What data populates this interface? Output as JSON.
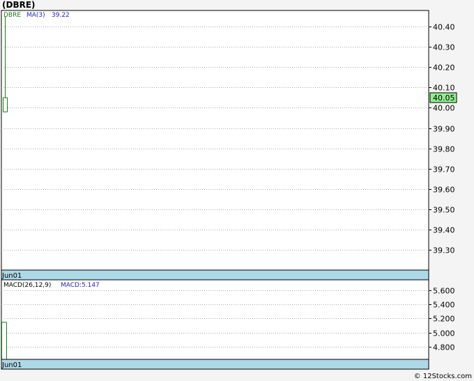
{
  "title": "(DBRE)",
  "credit": "© 12Stocks.com",
  "colors": {
    "up": "#1a7a1a",
    "ma": "#2222cc",
    "date_bar": "#add8e6",
    "last_price_bg": "#90ee90"
  },
  "chart_data": [
    {
      "type": "candlestick",
      "legend": {
        "symbol": "DBRE",
        "ma_label": "MA(3)",
        "ma_value": "39.22"
      },
      "ylim": [
        39.2,
        40.48
      ],
      "yticks": [
        40.4,
        40.3,
        40.2,
        40.1,
        40.0,
        39.9,
        39.8,
        39.7,
        39.6,
        39.5,
        39.4,
        39.3
      ],
      "ytick_labels": [
        "40.40",
        "40.30",
        "40.20",
        "40.10",
        "40.00",
        "39.90",
        "39.80",
        "39.70",
        "39.60",
        "39.50",
        "39.40",
        "39.30"
      ],
      "last_price": "40.05",
      "x_labels": [
        "Jun01"
      ],
      "candles": [
        {
          "date": "Jun01",
          "open": 39.98,
          "high": 40.45,
          "low": 39.98,
          "close": 40.05
        }
      ]
    },
    {
      "type": "bar",
      "legend": {
        "label": "MACD(26,12,9)",
        "value_label": "MACD:5.147"
      },
      "ylim": [
        4.62,
        5.75
      ],
      "yticks": [
        5.6,
        5.4,
        5.2,
        5.0,
        4.8
      ],
      "ytick_labels": [
        "5.600",
        "5.400",
        "5.200",
        "5.000",
        "4.800"
      ],
      "x_labels": [
        "Jun01"
      ],
      "values": [
        5.147
      ]
    }
  ]
}
